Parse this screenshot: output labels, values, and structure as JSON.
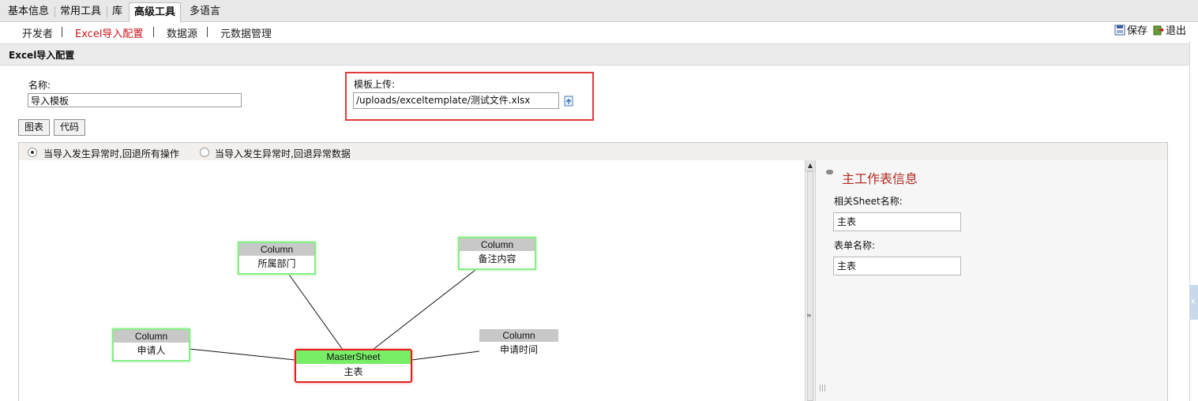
{
  "top_tabs": [
    {
      "label": "基本信息",
      "active": false
    },
    {
      "label": "常用工具",
      "active": false
    },
    {
      "label": "库",
      "active": false
    },
    {
      "label": "高级工具",
      "active": true
    },
    {
      "label": "多语言",
      "active": false
    }
  ],
  "sub_nav": [
    {
      "label": "开发者",
      "active": false
    },
    {
      "label": "Excel导入配置",
      "active": true
    },
    {
      "label": "数据源",
      "active": false
    },
    {
      "label": "元数据管理",
      "active": false
    }
  ],
  "toolbar": {
    "save_label": "保存",
    "exit_label": "退出"
  },
  "section": {
    "title": "Excel导入配置"
  },
  "form": {
    "name_label": "名称:",
    "name_value": "导入模板",
    "upload_label": "模板上传:",
    "upload_value": "/uploads/exceltemplate/测试文件.xlsx"
  },
  "view_buttons": {
    "chart": "图表",
    "code": "代码"
  },
  "options": [
    {
      "label": "当导入发生异常时,回退所有操作",
      "checked": true
    },
    {
      "label": "当导入发生异常时,回退异常数据",
      "checked": false
    }
  ],
  "diagram": {
    "nodes": {
      "dept": {
        "header": "Column",
        "body": "所属部门"
      },
      "remark": {
        "header": "Column",
        "body": "备注内容"
      },
      "applicant": {
        "header": "Column",
        "body": "申请人"
      },
      "time": {
        "header": "Column",
        "body": "申请时间"
      },
      "master": {
        "header": "MasterSheet",
        "body": "主表"
      }
    }
  },
  "side_panel": {
    "title": "主工作表信息",
    "sheet_label": "相关Sheet名称:",
    "sheet_value": "主表",
    "form_label": "表单名称:",
    "form_value": "主表"
  },
  "colors": {
    "accent_red": "#c8171d",
    "highlight_box": "#e23a3a",
    "master_header": "#77ee66",
    "column_border": "#88ee88"
  }
}
